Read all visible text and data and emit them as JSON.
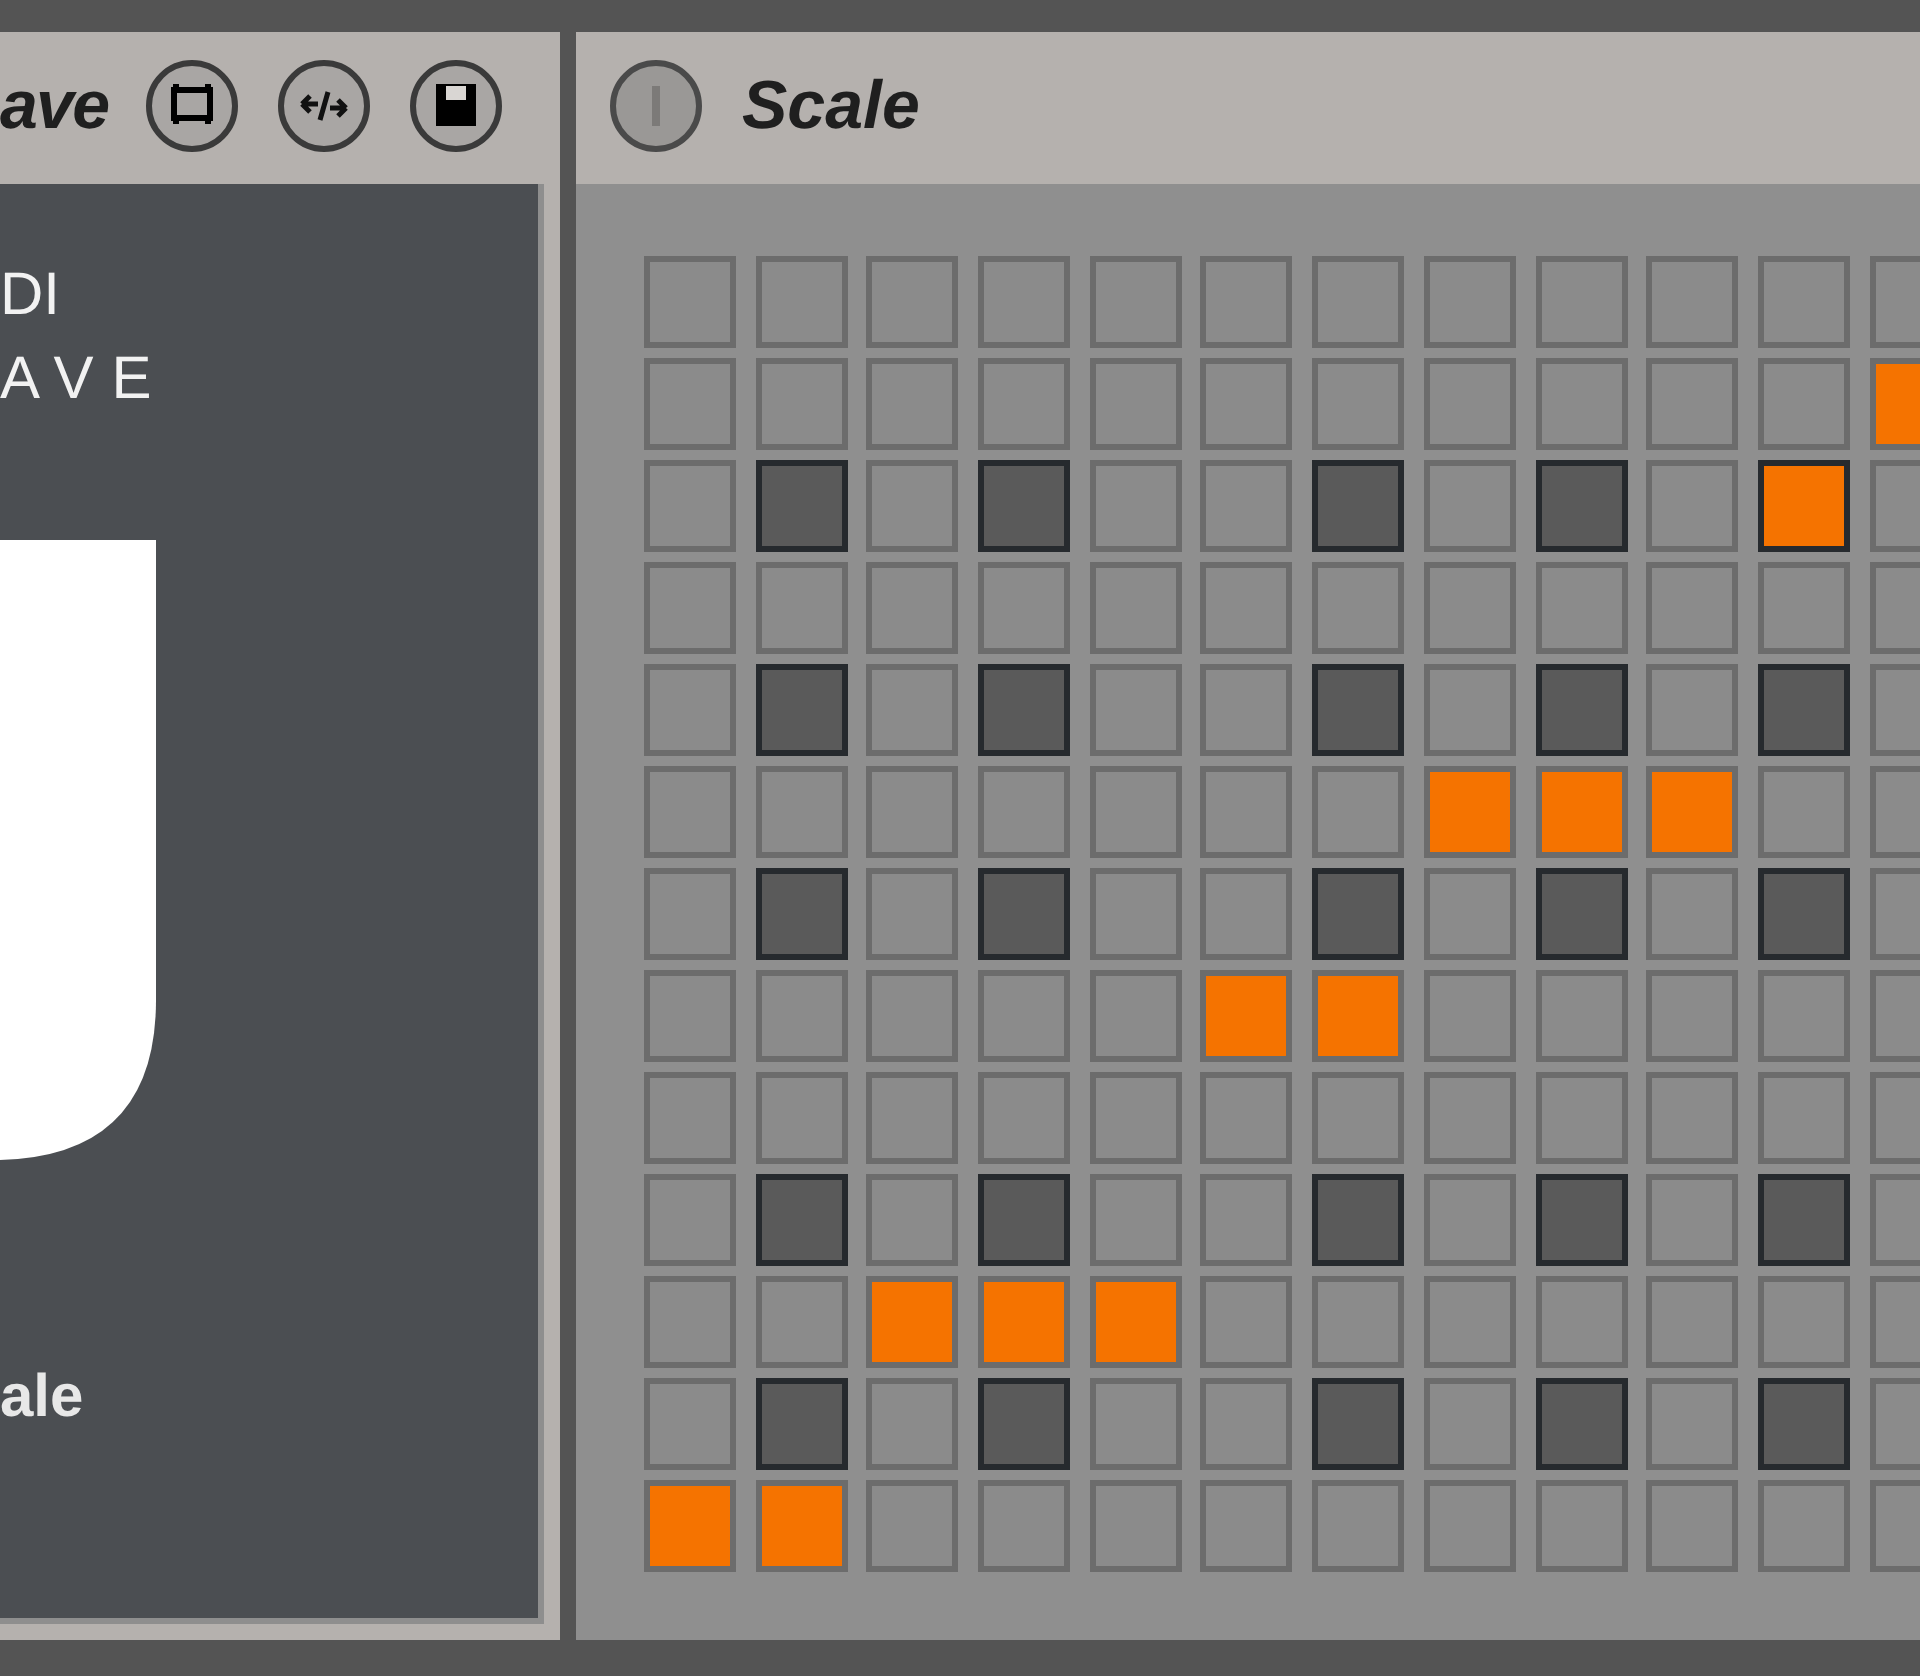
{
  "left_device": {
    "title": "ave",
    "header_buttons": [
      {
        "kind": "clip"
      },
      {
        "kind": "swap"
      },
      {
        "kind": "save"
      }
    ],
    "lines": [
      "DI",
      "AVE"
    ],
    "caption": "ale"
  },
  "right_device": {
    "title": "Scale",
    "on": false,
    "grid": [
      {
        "cells": [
          {
            "black": false,
            "on": false
          },
          {
            "black": false,
            "on": false
          },
          {
            "black": false,
            "on": false
          },
          {
            "black": false,
            "on": false
          },
          {
            "black": false,
            "on": false
          },
          {
            "black": false,
            "on": false
          },
          {
            "black": false,
            "on": false
          },
          {
            "black": false,
            "on": false
          },
          {
            "black": false,
            "on": false
          },
          {
            "black": false,
            "on": false
          },
          {
            "black": false,
            "on": false
          },
          {
            "black": false,
            "on": false
          }
        ]
      },
      {
        "cells": [
          {
            "black": false,
            "on": false
          },
          {
            "black": false,
            "on": false
          },
          {
            "black": false,
            "on": false
          },
          {
            "black": false,
            "on": false
          },
          {
            "black": false,
            "on": false
          },
          {
            "black": false,
            "on": false
          },
          {
            "black": false,
            "on": false
          },
          {
            "black": false,
            "on": false
          },
          {
            "black": false,
            "on": false
          },
          {
            "black": false,
            "on": false
          },
          {
            "black": false,
            "on": false
          },
          {
            "black": false,
            "on": true
          }
        ]
      },
      {
        "cells": [
          {
            "black": false,
            "on": false
          },
          {
            "black": true,
            "on": false
          },
          {
            "black": false,
            "on": false
          },
          {
            "black": true,
            "on": false
          },
          {
            "black": false,
            "on": false
          },
          {
            "black": false,
            "on": false
          },
          {
            "black": true,
            "on": false
          },
          {
            "black": false,
            "on": false
          },
          {
            "black": true,
            "on": false
          },
          {
            "black": false,
            "on": false
          },
          {
            "black": true,
            "on": true
          },
          {
            "black": false,
            "on": false
          }
        ]
      },
      {
        "cells": [
          {
            "black": false,
            "on": false
          },
          {
            "black": false,
            "on": false
          },
          {
            "black": false,
            "on": false
          },
          {
            "black": false,
            "on": false
          },
          {
            "black": false,
            "on": false
          },
          {
            "black": false,
            "on": false
          },
          {
            "black": false,
            "on": false
          },
          {
            "black": false,
            "on": false
          },
          {
            "black": false,
            "on": false
          },
          {
            "black": false,
            "on": false
          },
          {
            "black": false,
            "on": false
          },
          {
            "black": false,
            "on": false
          }
        ]
      },
      {
        "cells": [
          {
            "black": false,
            "on": false
          },
          {
            "black": true,
            "on": false
          },
          {
            "black": false,
            "on": false
          },
          {
            "black": true,
            "on": false
          },
          {
            "black": false,
            "on": false
          },
          {
            "black": false,
            "on": false
          },
          {
            "black": true,
            "on": false
          },
          {
            "black": false,
            "on": false
          },
          {
            "black": true,
            "on": false
          },
          {
            "black": false,
            "on": false
          },
          {
            "black": true,
            "on": false
          },
          {
            "black": false,
            "on": false
          }
        ]
      },
      {
        "cells": [
          {
            "black": false,
            "on": false
          },
          {
            "black": false,
            "on": false
          },
          {
            "black": false,
            "on": false
          },
          {
            "black": false,
            "on": false
          },
          {
            "black": false,
            "on": false
          },
          {
            "black": false,
            "on": false
          },
          {
            "black": false,
            "on": false
          },
          {
            "black": false,
            "on": true
          },
          {
            "black": false,
            "on": true
          },
          {
            "black": false,
            "on": true
          },
          {
            "black": false,
            "on": false
          },
          {
            "black": false,
            "on": false
          }
        ]
      },
      {
        "cells": [
          {
            "black": false,
            "on": false
          },
          {
            "black": true,
            "on": false
          },
          {
            "black": false,
            "on": false
          },
          {
            "black": true,
            "on": false
          },
          {
            "black": false,
            "on": false
          },
          {
            "black": false,
            "on": false
          },
          {
            "black": true,
            "on": false
          },
          {
            "black": false,
            "on": false
          },
          {
            "black": true,
            "on": false
          },
          {
            "black": false,
            "on": false
          },
          {
            "black": true,
            "on": false
          },
          {
            "black": false,
            "on": false
          }
        ]
      },
      {
        "cells": [
          {
            "black": false,
            "on": false
          },
          {
            "black": false,
            "on": false
          },
          {
            "black": false,
            "on": false
          },
          {
            "black": false,
            "on": false
          },
          {
            "black": false,
            "on": false
          },
          {
            "black": false,
            "on": true
          },
          {
            "black": false,
            "on": true
          },
          {
            "black": false,
            "on": false
          },
          {
            "black": false,
            "on": false
          },
          {
            "black": false,
            "on": false
          },
          {
            "black": false,
            "on": false
          },
          {
            "black": false,
            "on": false
          }
        ]
      },
      {
        "cells": [
          {
            "black": false,
            "on": false
          },
          {
            "black": false,
            "on": false
          },
          {
            "black": false,
            "on": false
          },
          {
            "black": false,
            "on": false
          },
          {
            "black": false,
            "on": false
          },
          {
            "black": false,
            "on": false
          },
          {
            "black": false,
            "on": false
          },
          {
            "black": false,
            "on": false
          },
          {
            "black": false,
            "on": false
          },
          {
            "black": false,
            "on": false
          },
          {
            "black": false,
            "on": false
          },
          {
            "black": false,
            "on": false
          }
        ]
      },
      {
        "cells": [
          {
            "black": false,
            "on": false
          },
          {
            "black": true,
            "on": false
          },
          {
            "black": false,
            "on": false
          },
          {
            "black": true,
            "on": false
          },
          {
            "black": false,
            "on": false
          },
          {
            "black": false,
            "on": false
          },
          {
            "black": true,
            "on": false
          },
          {
            "black": false,
            "on": false
          },
          {
            "black": true,
            "on": false
          },
          {
            "black": false,
            "on": false
          },
          {
            "black": true,
            "on": false
          },
          {
            "black": false,
            "on": false
          }
        ]
      },
      {
        "cells": [
          {
            "black": false,
            "on": false
          },
          {
            "black": false,
            "on": false
          },
          {
            "black": false,
            "on": true
          },
          {
            "black": false,
            "on": true
          },
          {
            "black": false,
            "on": true
          },
          {
            "black": false,
            "on": false
          },
          {
            "black": false,
            "on": false
          },
          {
            "black": false,
            "on": false
          },
          {
            "black": false,
            "on": false
          },
          {
            "black": false,
            "on": false
          },
          {
            "black": false,
            "on": false
          },
          {
            "black": false,
            "on": false
          }
        ]
      },
      {
        "cells": [
          {
            "black": false,
            "on": false
          },
          {
            "black": true,
            "on": false
          },
          {
            "black": false,
            "on": false
          },
          {
            "black": true,
            "on": false
          },
          {
            "black": false,
            "on": false
          },
          {
            "black": false,
            "on": false
          },
          {
            "black": true,
            "on": false
          },
          {
            "black": false,
            "on": false
          },
          {
            "black": true,
            "on": false
          },
          {
            "black": false,
            "on": false
          },
          {
            "black": true,
            "on": false
          },
          {
            "black": false,
            "on": false
          }
        ]
      },
      {
        "cells": [
          {
            "black": false,
            "on": true
          },
          {
            "black": false,
            "on": true
          },
          {
            "black": false,
            "on": false
          },
          {
            "black": false,
            "on": false
          },
          {
            "black": false,
            "on": false
          },
          {
            "black": false,
            "on": false
          },
          {
            "black": false,
            "on": false
          },
          {
            "black": false,
            "on": false
          },
          {
            "black": false,
            "on": false
          },
          {
            "black": false,
            "on": false
          },
          {
            "black": false,
            "on": false
          },
          {
            "black": false,
            "on": false
          }
        ]
      }
    ]
  }
}
